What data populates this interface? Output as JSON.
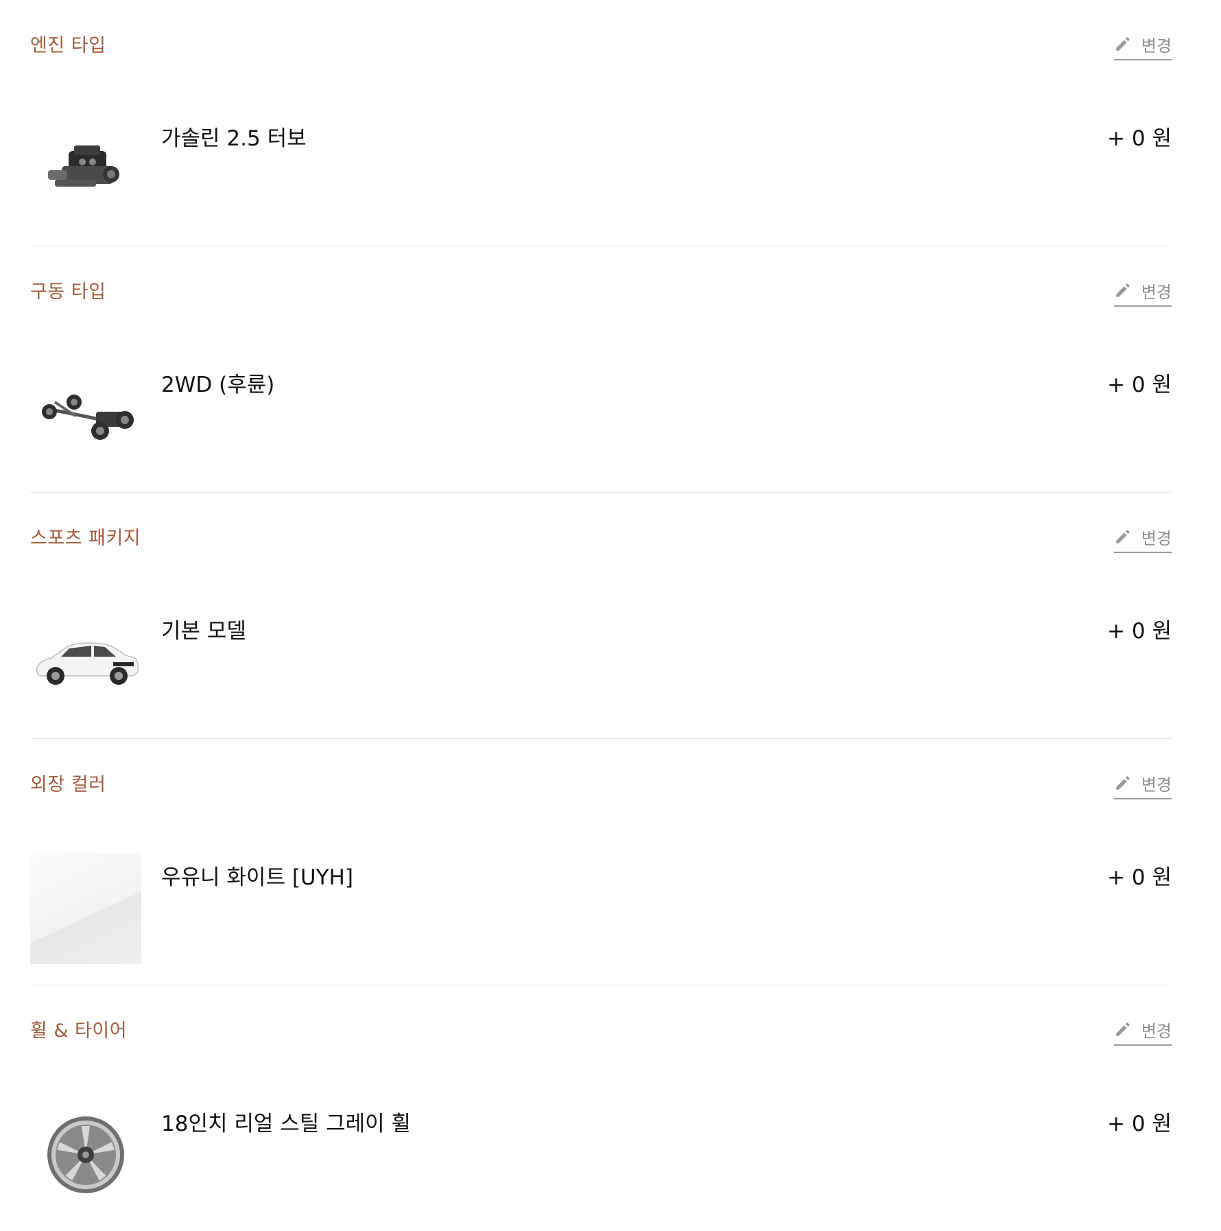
{
  "edit_label": "변경",
  "sections": [
    {
      "title": "엔진 타입",
      "name": "가솔린 2.5 터보",
      "price": "+ 0 원",
      "icon": "engine-icon"
    },
    {
      "title": "구동 타입",
      "name": "2WD (후륜)",
      "price": "+ 0 원",
      "icon": "drivetrain-icon"
    },
    {
      "title": "스포츠 패키지",
      "name": "기본 모델",
      "price": "+ 0 원",
      "icon": "car-icon"
    },
    {
      "title": "외장 컬러",
      "name": "우유니 화이트 [UYH]",
      "price": "+ 0 원",
      "icon": "color-swatch",
      "color": "#f2f2f2"
    },
    {
      "title": "휠 & 타이어",
      "name": "18인치 리얼 스틸 그레이 휠",
      "price": "+ 0 원",
      "icon": "wheel-icon"
    }
  ],
  "colors": {
    "accent": "#a25d3e",
    "edit": "#8f8f8f",
    "divider": "#e4e4e4"
  }
}
